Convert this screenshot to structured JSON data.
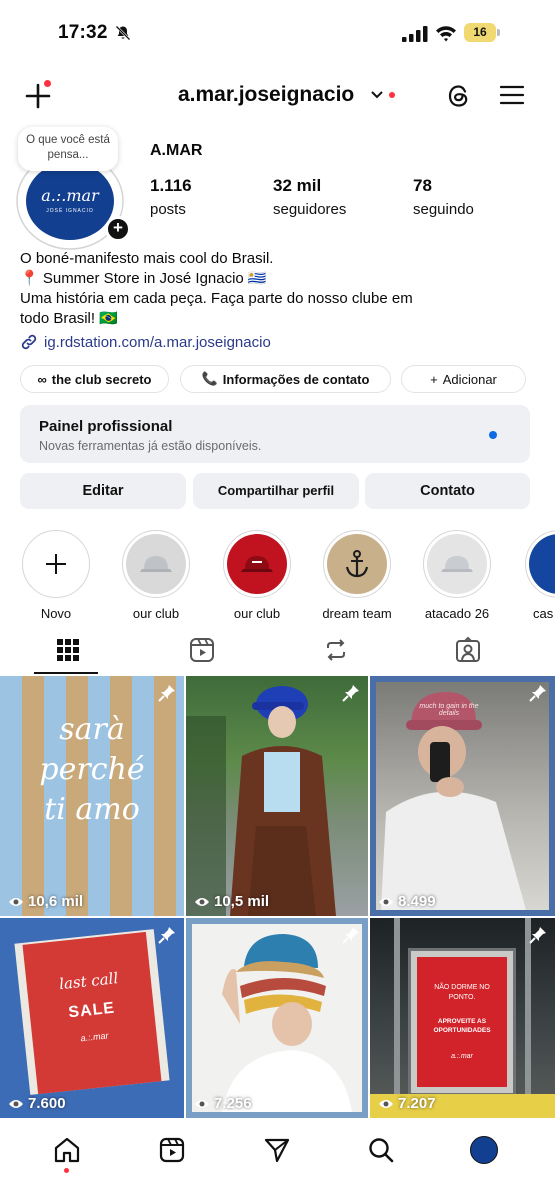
{
  "status_bar": {
    "time": "17:32",
    "battery": "16"
  },
  "header": {
    "username": "a.mar.joseignacio"
  },
  "profile": {
    "note": "O que você está pensa...",
    "avatar_text": "a.:.mar",
    "avatar_sub": "JOSÉ IGNACIO",
    "display_name": "A.MAR",
    "stats": [
      {
        "value": "1.116",
        "label": "posts"
      },
      {
        "value": "32 mil",
        "label": "seguidores"
      },
      {
        "value": "78",
        "label": "seguindo"
      }
    ],
    "bio": [
      "O boné-manifesto mais cool do Brasil.",
      "📍 Summer Store in José Ignacio 🇺🇾",
      "Uma história em cada peça. Faça parte do nosso clube em",
      "todo Brasil! 🇧🇷"
    ],
    "link": "ig.rdstation.com/a.mar.joseignacio"
  },
  "chips": [
    {
      "icon": "∞",
      "label": "the club secreto"
    },
    {
      "icon": "📞",
      "label": "Informações de contato"
    },
    {
      "icon": "+",
      "label": "Adicionar"
    }
  ],
  "pro_panel": {
    "title": "Painel profissional",
    "subtitle": "Novas ferramentas já estão disponíveis."
  },
  "actions": {
    "edit": "Editar",
    "share": "Compartilhar perfil",
    "contact": "Contato"
  },
  "highlights": [
    {
      "label": "Novo"
    },
    {
      "label": "our club"
    },
    {
      "label": "our club"
    },
    {
      "label": "dream team"
    },
    {
      "label": "atacado 26"
    },
    {
      "label": "cas"
    }
  ],
  "posts": [
    {
      "views": "10,6 mil",
      "text": "sarà perché ti amo"
    },
    {
      "views": "10,5 mil"
    },
    {
      "views": "8.499",
      "cap_text": "much to gain in the details"
    },
    {
      "views": "7.600",
      "text1": "last call",
      "text2": "SALE",
      "text3": "a.:.mar"
    },
    {
      "views": "7.256"
    },
    {
      "views": "7.207",
      "line1": "NÃO DORME NO PONTO.",
      "line2": "APROVEITE AS OPORTUNIDADES",
      "line3": "a.:.mar"
    }
  ],
  "colors": {
    "accent": "#0d69e4",
    "notification": "#ff3040",
    "brand": "#123f8f",
    "link": "#2b3a8a"
  }
}
